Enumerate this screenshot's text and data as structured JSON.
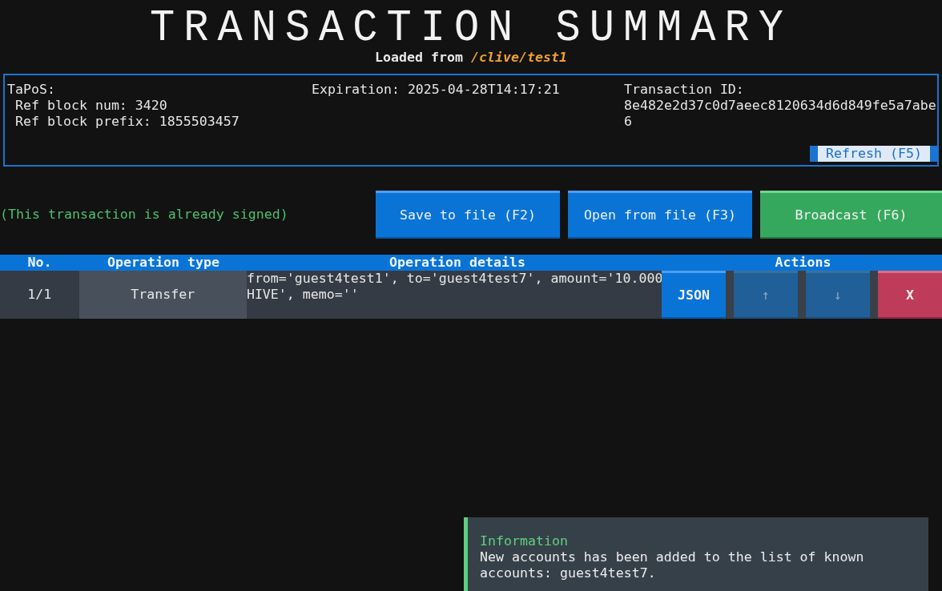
{
  "header": {
    "title": "TRANSACTION SUMMARY",
    "loaded_label": "Loaded from",
    "loaded_path": "/clive/test1"
  },
  "details": {
    "tapos_label": "TaPoS:",
    "ref_block_num": "Ref block num: 3420",
    "ref_block_prefix": "Ref block prefix: 1855503457",
    "expiration": "Expiration: 2025-04-28T14:17:21",
    "transaction_id_label": "Transaction ID:",
    "transaction_id": "8e482e2d37c0d7aeec8120634d6d849fe5a7abe6",
    "refresh_button": "Refresh (F5)"
  },
  "status_message": "(This transaction is already signed)",
  "buttons": [
    {
      "label": "Save to file (F2)",
      "kind": "primary"
    },
    {
      "label": "Open from file (F3)",
      "kind": "primary"
    },
    {
      "label": "Broadcast (F6)",
      "kind": "success"
    }
  ],
  "table": {
    "columns": [
      "No.",
      "Operation type",
      "Operation details",
      "Actions"
    ],
    "rows": [
      {
        "number": "1/1",
        "type": "Transfer",
        "details": "from='guest4test1', to='guest4test7', amount='10.000 HIVE', memo=''",
        "actions": [
          {
            "label": "JSON",
            "kind": "primary",
            "disabled": false
          },
          {
            "label": "↑",
            "kind": "primary",
            "disabled": true
          },
          {
            "label": "↓",
            "kind": "primary",
            "disabled": true
          },
          {
            "label": "X",
            "kind": "danger",
            "disabled": false
          }
        ]
      }
    ]
  },
  "notification": {
    "kind": "information",
    "title": "Information",
    "message": "New accounts has been added to the list of known accounts: guest4test7."
  }
}
